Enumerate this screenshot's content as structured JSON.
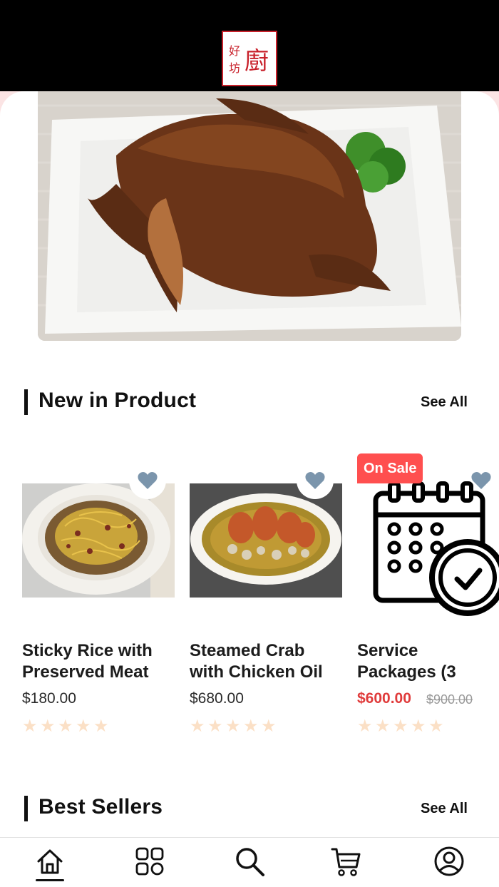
{
  "header": {
    "logo": {
      "text": "好坊 廚",
      "border_color": "#c8202a"
    }
  },
  "banner": {
    "icon": "roast-goose-photo"
  },
  "sections": {
    "new": {
      "title": "New in Product",
      "see_all": "See All"
    },
    "best": {
      "title": "Best Sellers",
      "see_all": "See All"
    }
  },
  "products": [
    {
      "title": "Sticky Rice with Preserved Meat",
      "price": "$180.00",
      "rating": 0,
      "image_icon": "sticky-rice-photo",
      "favorite_icon": "heart-icon"
    },
    {
      "title": "Steamed Crab with Chicken Oil",
      "price": "$680.00",
      "rating": 0,
      "image_icon": "steamed-crab-photo",
      "favorite_icon": "heart-icon"
    },
    {
      "title": "Service Packages (3",
      "badge": "On Sale",
      "price": "$600.00",
      "original_price": "$900.00",
      "rating": 0,
      "image_icon": "calendar-clock-icon",
      "favorite_icon": "heart-icon"
    }
  ],
  "bottom_nav": [
    {
      "icon": "home-icon",
      "active": true
    },
    {
      "icon": "grid-icon",
      "active": false
    },
    {
      "icon": "search-icon",
      "active": false
    },
    {
      "icon": "cart-icon",
      "active": false
    },
    {
      "icon": "profile-icon",
      "active": false
    }
  ],
  "colors": {
    "accent_red": "#e03b3b",
    "badge_red": "#ff4f4f",
    "heart": "#7b95ac",
    "star": "#fbe0c6",
    "topbar": "#000000"
  }
}
